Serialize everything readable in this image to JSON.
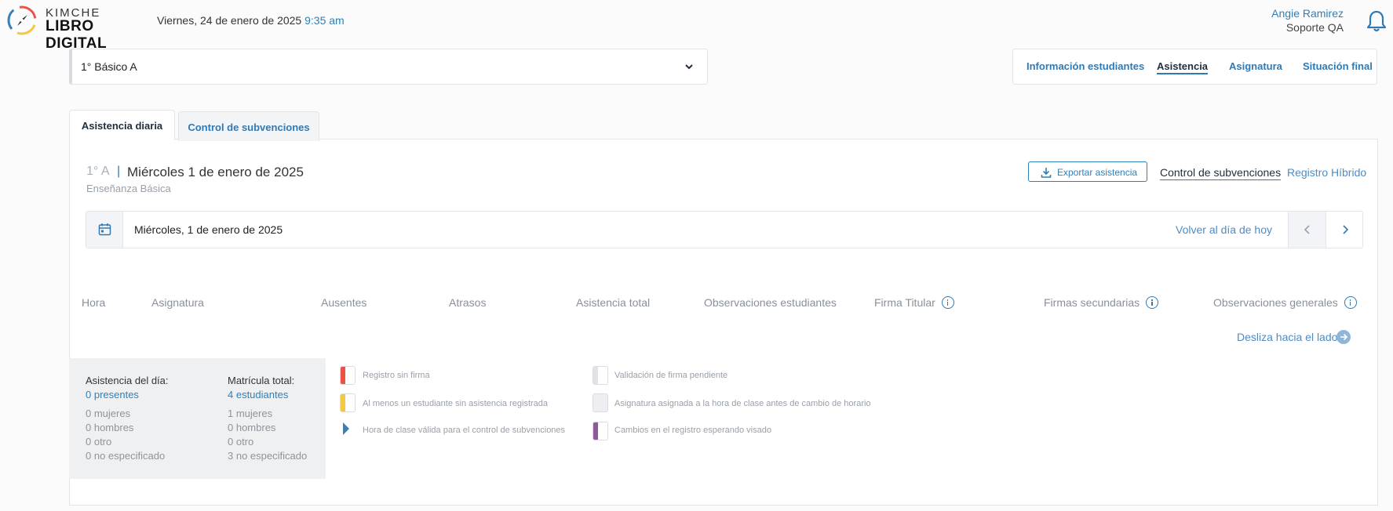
{
  "header": {
    "logo_top": "KIMCHE",
    "logo_bottom": "LIBRO DIGITAL",
    "date": "Viernes, 24 de enero de 2025",
    "time": "9:35 am",
    "user_name": "Angie Ramirez",
    "user_role": "Soporte QA"
  },
  "course_select": {
    "value": "1° Básico A"
  },
  "top_nav": [
    {
      "label": "Información estudiantes",
      "active": false
    },
    {
      "label": "Asistencia",
      "active": true
    },
    {
      "label": "Asignatura",
      "active": false
    },
    {
      "label": "Situación final",
      "active": false
    }
  ],
  "tabs": [
    {
      "label": "Asistencia diaria",
      "active": true
    },
    {
      "label": "Control de subvenciones",
      "active": false
    }
  ],
  "course_info": {
    "code": "1° A",
    "separator": "|",
    "day": "Miércoles 1 de enero de 2025",
    "level": "Enseñanza Básica"
  },
  "actions": {
    "export": "Exportar asistencia",
    "subsidies": "Control de subvenciones",
    "hybrid": "Registro Híbrido"
  },
  "date_bar": {
    "value": "Miércoles, 1 de enero de 2025",
    "back_today": "Volver al día de hoy"
  },
  "table_headers": [
    "Hora",
    "Asignatura",
    "Ausentes",
    "Atrasos",
    "Asistencia total",
    "Observaciones estudiantes",
    "Firma Titular",
    "Firmas secundarias",
    "Observaciones generales"
  ],
  "slide_hint": "Desliza hacia el lado",
  "summary": {
    "day_title": "Asistencia del día:",
    "day_value": "0 presentes",
    "day_lines": [
      "0 mujeres",
      "0 hombres",
      "0 otro",
      "0 no especificado"
    ],
    "total_title": "Matrícula total:",
    "total_value": "4 estudiantes",
    "total_lines": [
      "1 mujeres",
      "0 hombres",
      "0 otro",
      "3 no especificado"
    ]
  },
  "legend": [
    {
      "label": "Registro sin firma",
      "color": "#e8534a"
    },
    {
      "label": "Al menos un estudiante sin asistencia registrada",
      "color": "#f5c842"
    },
    {
      "label": "Hora de clase válida para el control de subvenciones",
      "color": "#3a7fb5"
    },
    {
      "label": "Validación de firma pendiente",
      "color": "#dfe2e6"
    },
    {
      "label": "Asignatura asignada a la hora de clase antes de cambio de horario",
      "color": "#eceef1"
    },
    {
      "label": "Cambios en el registro esperando visado",
      "color": "#8e5a9a"
    }
  ]
}
